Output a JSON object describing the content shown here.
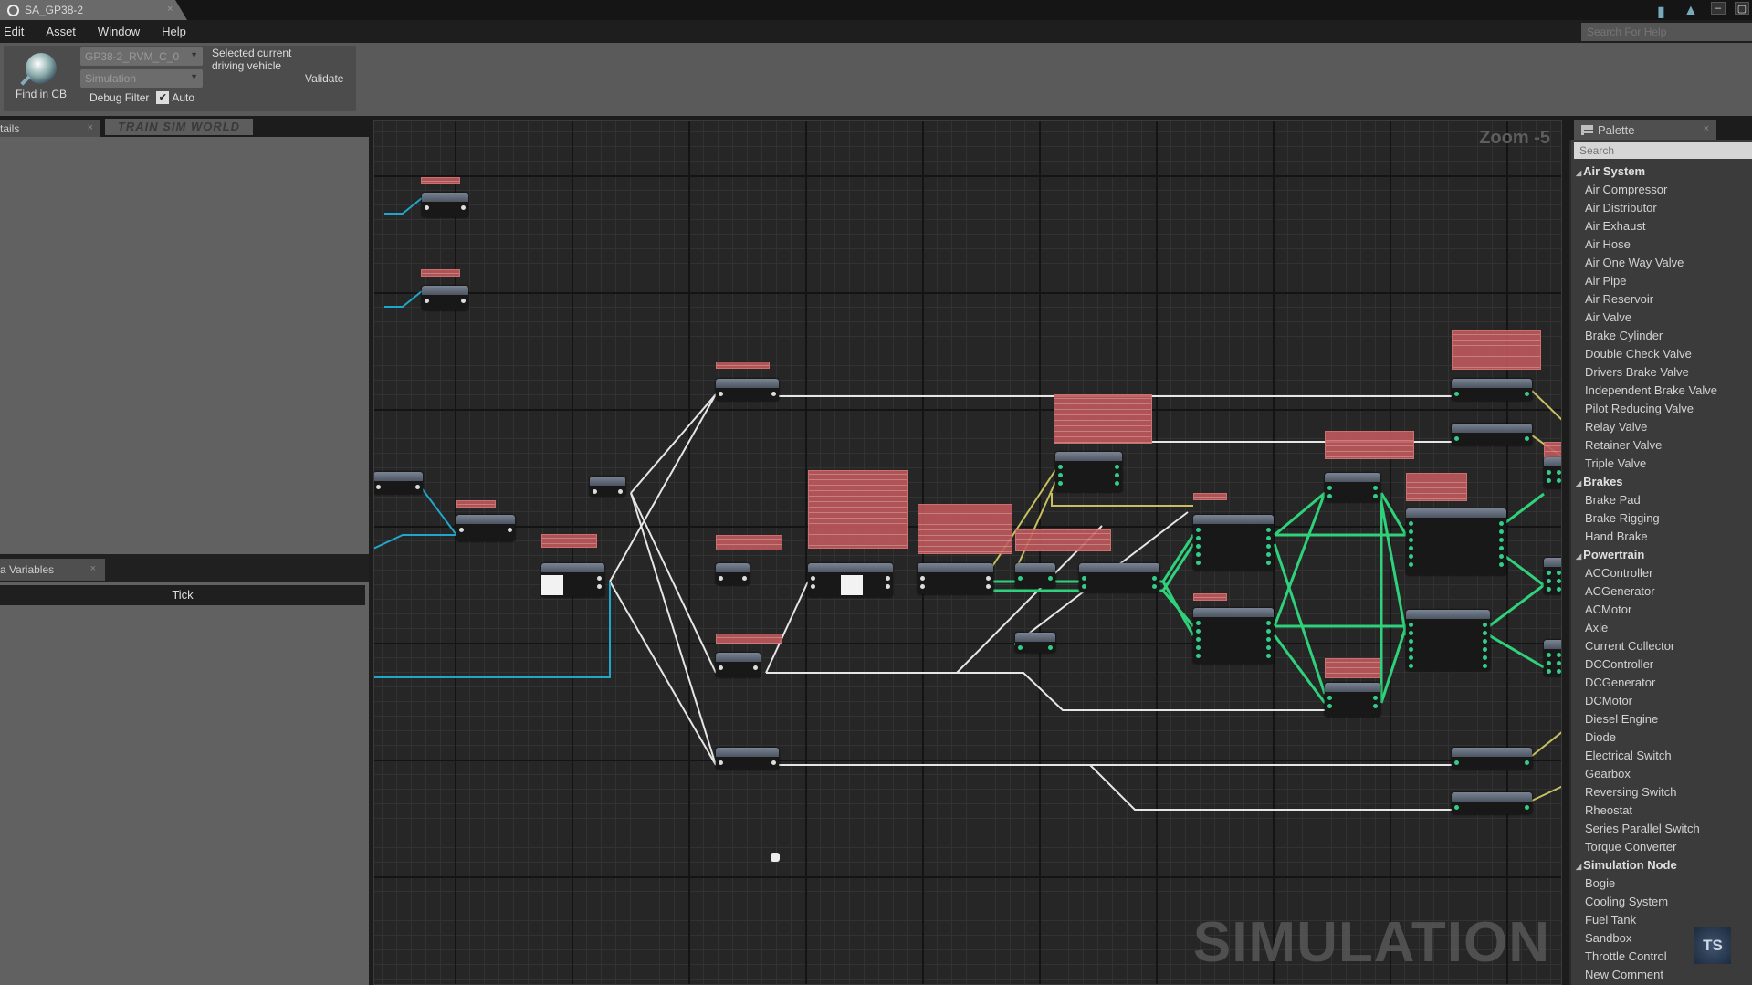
{
  "window": {
    "tab_title": "SA_GP38-2",
    "help_search_placeholder": "Search For Help"
  },
  "menu": [
    "Edit",
    "Asset",
    "Window",
    "Help"
  ],
  "toolbar": {
    "find_in_cb": "Find in CB",
    "vehicle_select": "GP38-2_RVM_C_0",
    "mode_select": "Simulation",
    "selected_text": "Selected current driving vehicle",
    "validate": "Validate",
    "debug_filter": "Debug Filter",
    "auto_label": "Auto",
    "auto_checked": true
  },
  "watermark_brand": "TRAIN SIM WORLD",
  "left": {
    "details_tab": "tails",
    "variables_tab": "a Variables",
    "tick_label": "Tick"
  },
  "graph": {
    "zoom": "Zoom -5",
    "watermark": "SIMULATION"
  },
  "palette": {
    "tab": "Palette",
    "search_placeholder": "Search",
    "categories": [
      {
        "name": "Air System",
        "items": [
          "Air Compressor",
          "Air Distributor",
          "Air Exhaust",
          "Air Hose",
          "Air One Way Valve",
          "Air Pipe",
          "Air Reservoir",
          "Air Valve",
          "Brake Cylinder",
          "Double Check Valve",
          "Drivers Brake Valve",
          "Independent Brake Valve",
          "Pilot Reducing Valve",
          "Relay Valve",
          "Retainer Valve",
          "Triple Valve"
        ]
      },
      {
        "name": "Brakes",
        "items": [
          "Brake Pad",
          "Brake Rigging",
          "Hand Brake"
        ]
      },
      {
        "name": "Powertrain",
        "items": [
          "ACController",
          "ACGenerator",
          "ACMotor",
          "Axle",
          "Current Collector",
          "DCController",
          "DCGenerator",
          "DCMotor",
          "Diesel Engine",
          "Diode",
          "Electrical Switch",
          "Gearbox",
          "Reversing Switch",
          "Rheostat",
          "Series Parallel Switch",
          "Torque Converter"
        ]
      },
      {
        "name": "Simulation Node",
        "items": [
          "Bogie",
          "Cooling System",
          "Fuel Tank",
          "Sandbox",
          "Throttle Control",
          "New Comment"
        ]
      }
    ]
  },
  "corner_logo": "TS",
  "colors": {
    "wire_white": "#e6e6e6",
    "wire_green": "#2fd27a",
    "wire_cyan": "#1fa6c8",
    "wire_yellow": "#c8c060",
    "comment": "#c0585c"
  }
}
